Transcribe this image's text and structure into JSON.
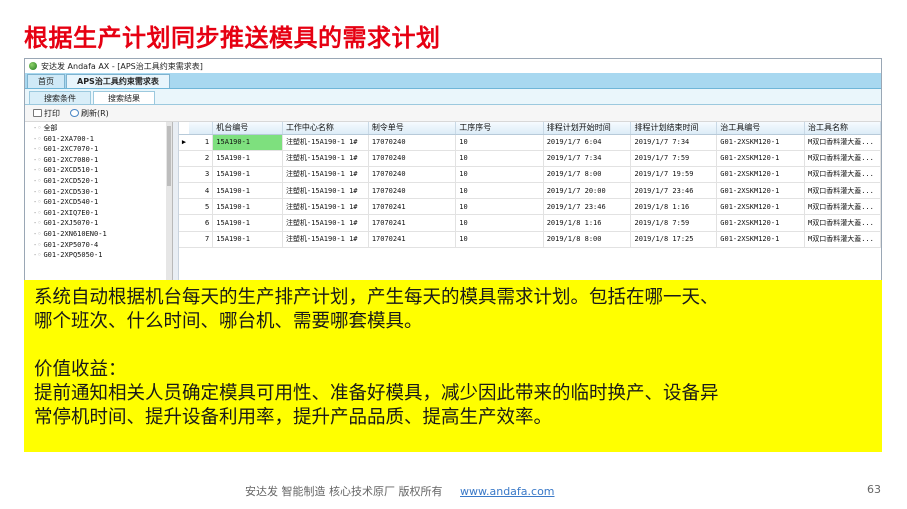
{
  "slide": {
    "title": "根据生产计划同步推送模具的需求计划",
    "footer_text": "安达发  智能制造 核心技术原厂   版权所有",
    "footer_link": "www.andafa.com",
    "page_number": "63"
  },
  "window": {
    "title": "安达发 Andafa AX - [APS治工具约束需求表]",
    "tabs": [
      "首页",
      "APS治工具约束需求表"
    ],
    "subtabs": [
      "搜索条件",
      "搜索结果"
    ],
    "toolbar": {
      "print_label": "打印",
      "refresh_label": "刷新(R)"
    }
  },
  "tree": {
    "items": [
      "全部",
      "G01-2XA700-1",
      "G01-2XC7070-1",
      "G01-2XC7080-1",
      "G01-2XCD510-1",
      "G01-2XCD520-1",
      "G01-2XCD530-1",
      "G01-2XCD540-1",
      "G01-2XIQ7E0-1",
      "G01-2XJ5070-1",
      "G01-2XN610EN0-1",
      "G01-2XP5070-4",
      "G01-2XPQ5050-1"
    ]
  },
  "table": {
    "columns": [
      "机台编号",
      "工作中心名称",
      "制令单号",
      "工序序号",
      "排程计划开始时间",
      "排程计划结束时间",
      "治工具编号",
      "治工具名称"
    ],
    "rows": [
      {
        "num": "1",
        "cells": [
          "15A190-1",
          "注塑机-15A190-1 1#",
          "17070240",
          "10",
          "2019/1/7 6:04",
          "2019/1/7 7:34",
          "G01-2XSKM120-1",
          "M双口香料灌大蓋..."
        ]
      },
      {
        "num": "2",
        "cells": [
          "15A190-1",
          "注塑机-15A190-1 1#",
          "17070240",
          "10",
          "2019/1/7 7:34",
          "2019/1/7 7:59",
          "G01-2XSKM120-1",
          "M双口香料灌大蓋..."
        ]
      },
      {
        "num": "3",
        "cells": [
          "15A190-1",
          "注塑机-15A190-1 1#",
          "17070240",
          "10",
          "2019/1/7 8:00",
          "2019/1/7 19:59",
          "G01-2XSKM120-1",
          "M双口香料灌大蓋..."
        ]
      },
      {
        "num": "4",
        "cells": [
          "15A190-1",
          "注塑机-15A190-1 1#",
          "17070240",
          "10",
          "2019/1/7 20:00",
          "2019/1/7 23:46",
          "G01-2XSKM120-1",
          "M双口香料灌大蓋..."
        ]
      },
      {
        "num": "5",
        "cells": [
          "15A190-1",
          "注塑机-15A190-1 1#",
          "17070241",
          "10",
          "2019/1/7 23:46",
          "2019/1/8 1:16",
          "G01-2XSKM120-1",
          "M双口香料灌大蓋..."
        ]
      },
      {
        "num": "6",
        "cells": [
          "15A190-1",
          "注塑机-15A190-1 1#",
          "17070241",
          "10",
          "2019/1/8 1:16",
          "2019/1/8 7:59",
          "G01-2XSKM120-1",
          "M双口香料灌大蓋..."
        ]
      },
      {
        "num": "7",
        "cells": [
          "15A190-1",
          "注塑机-15A190-1 1#",
          "17070241",
          "10",
          "2019/1/8 8:00",
          "2019/1/8 17:25",
          "G01-2XSKM120-1",
          "M双口香料灌大蓋..."
        ]
      }
    ],
    "selected_color": "#7ee07e"
  },
  "callout": {
    "line1": "系统自动根据机台每天的生产排产计划，产生每天的模具需求计划。包括在哪一天、",
    "line2": "哪个班次、什么时间、哪台机、需要哪套模具。",
    "line3": "价值收益：",
    "line4": "提前通知相关人员确定模具可用性、准备好模具，减少因此带来的临时换产、设备异",
    "line5": "常停机时间、提升设备利用率，提升产品品质、提高生产效率。",
    "background": "#ffff00"
  },
  "colors": {
    "title_red": "#e60012",
    "tab_blue": "#a8d8f0"
  }
}
